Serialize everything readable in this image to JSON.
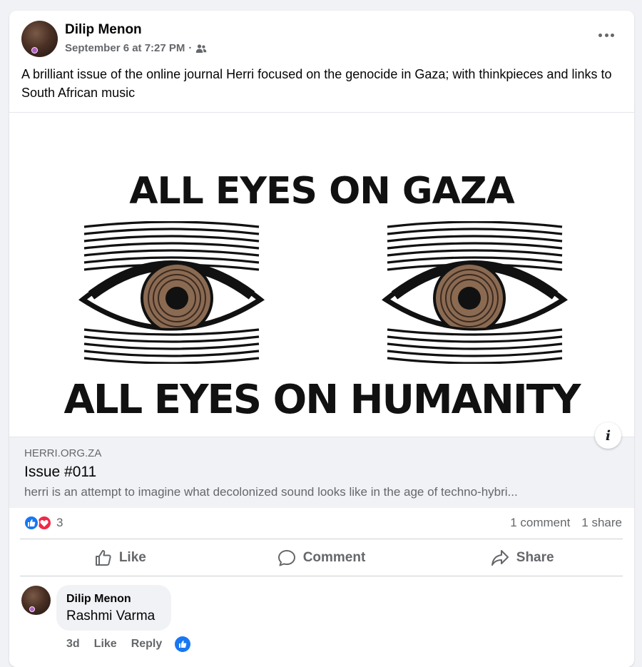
{
  "post": {
    "author": "Dilip Menon",
    "timestamp": "September 6 at 7:27 PM",
    "separator": "·",
    "audience_icon": "friends-icon",
    "more_icon": "more-options-icon",
    "text": "A brilliant issue of the online journal Herri focused on the genocide in Gaza; with thinkpieces and links to South African music"
  },
  "media": {
    "headline_top": "ALL EYES ON GAZA",
    "headline_bottom": "ALL EYES ON HUMANITY",
    "info_icon": "info-icon",
    "info_label": "i"
  },
  "link_preview": {
    "domain": "HERRI.ORG.ZA",
    "title": "Issue #011",
    "description": "herri is an attempt to imagine what decolonized sound looks like in the age of techno-hybri..."
  },
  "stats": {
    "reaction_icons": [
      "like-reaction-icon",
      "love-reaction-icon"
    ],
    "reaction_count": "3",
    "comments": "1 comment",
    "shares": "1 share"
  },
  "actions": {
    "like": "Like",
    "comment": "Comment",
    "share": "Share"
  },
  "comment": {
    "author": "Dilip Menon",
    "text": "Rashmi Varma",
    "age": "3d",
    "like": "Like",
    "reply": "Reply"
  },
  "colors": {
    "accent": "#1877f2",
    "love": "#f02849",
    "secondary_text": "#65676b",
    "page_background": "#f0f2f5"
  }
}
